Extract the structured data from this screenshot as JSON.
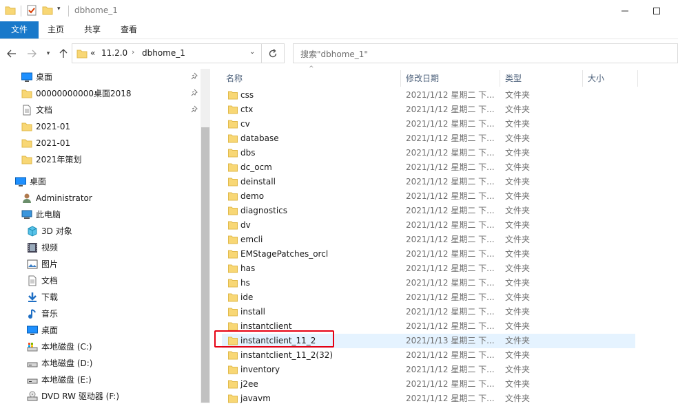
{
  "window": {
    "title": "dbhome_1"
  },
  "ribbon": {
    "tabs": [
      "文件",
      "主页",
      "共享",
      "查看"
    ]
  },
  "address": {
    "overflow": "«",
    "segments": [
      "11.2.0",
      "dbhome_1"
    ]
  },
  "search": {
    "placeholder": "搜索\"dbhome_1\""
  },
  "nav": {
    "quick_access": [
      {
        "label": "桌面",
        "icon": "desktop-icon",
        "pinned": true
      },
      {
        "label": "00000000000桌面2018",
        "icon": "folder-icon",
        "pinned": true
      },
      {
        "label": "文档",
        "icon": "document-icon",
        "pinned": true
      },
      {
        "label": "2021-01",
        "icon": "folder-icon",
        "pinned": false
      },
      {
        "label": "2021-01",
        "icon": "folder-icon",
        "pinned": false
      },
      {
        "label": "2021年策划",
        "icon": "folder-icon",
        "pinned": false
      }
    ],
    "desktop_label": "桌面",
    "user_label": "Administrator",
    "pc_label": "此电脑",
    "pc_items": [
      {
        "label": "3D 对象",
        "icon": "cube-3d-icon"
      },
      {
        "label": "视频",
        "icon": "video-icon"
      },
      {
        "label": "图片",
        "icon": "pictures-icon"
      },
      {
        "label": "文档",
        "icon": "document-icon"
      },
      {
        "label": "下载",
        "icon": "download-icon"
      },
      {
        "label": "音乐",
        "icon": "music-icon"
      },
      {
        "label": "桌面",
        "icon": "desktop-icon"
      },
      {
        "label": "本地磁盘 (C:)",
        "icon": "system-drive-icon"
      },
      {
        "label": "本地磁盘 (D:)",
        "icon": "drive-icon"
      },
      {
        "label": "本地磁盘 (E:)",
        "icon": "drive-icon"
      },
      {
        "label": "DVD RW 驱动器 (F:)",
        "icon": "dvd-drive-icon"
      }
    ]
  },
  "list": {
    "columns": {
      "name": "名称",
      "modified": "修改日期",
      "type": "类型",
      "size": "大小"
    },
    "files": [
      {
        "name": "css",
        "modified": "2021/1/12 星期二 下...",
        "type": "文件夹"
      },
      {
        "name": "ctx",
        "modified": "2021/1/12 星期二 下...",
        "type": "文件夹"
      },
      {
        "name": "cv",
        "modified": "2021/1/12 星期二 下...",
        "type": "文件夹"
      },
      {
        "name": "database",
        "modified": "2021/1/12 星期二 下...",
        "type": "文件夹"
      },
      {
        "name": "dbs",
        "modified": "2021/1/12 星期二 下...",
        "type": "文件夹"
      },
      {
        "name": "dc_ocm",
        "modified": "2021/1/12 星期二 下...",
        "type": "文件夹"
      },
      {
        "name": "deinstall",
        "modified": "2021/1/12 星期二 下...",
        "type": "文件夹"
      },
      {
        "name": "demo",
        "modified": "2021/1/12 星期二 下...",
        "type": "文件夹"
      },
      {
        "name": "diagnostics",
        "modified": "2021/1/12 星期二 下...",
        "type": "文件夹"
      },
      {
        "name": "dv",
        "modified": "2021/1/12 星期二 下...",
        "type": "文件夹"
      },
      {
        "name": "emcli",
        "modified": "2021/1/12 星期二 下...",
        "type": "文件夹"
      },
      {
        "name": "EMStagePatches_orcl",
        "modified": "2021/1/12 星期二 下...",
        "type": "文件夹"
      },
      {
        "name": "has",
        "modified": "2021/1/12 星期二 下...",
        "type": "文件夹"
      },
      {
        "name": "hs",
        "modified": "2021/1/12 星期二 下...",
        "type": "文件夹"
      },
      {
        "name": "ide",
        "modified": "2021/1/12 星期二 下...",
        "type": "文件夹"
      },
      {
        "name": "install",
        "modified": "2021/1/12 星期二 下...",
        "type": "文件夹"
      },
      {
        "name": "instantclient",
        "modified": "2021/1/12 星期二 下...",
        "type": "文件夹"
      },
      {
        "name": "instantclient_11_2",
        "modified": "2021/1/13 星期三 下...",
        "type": "文件夹",
        "selected": true
      },
      {
        "name": "instantclient_11_2(32)",
        "modified": "2021/1/12 星期二 下...",
        "type": "文件夹"
      },
      {
        "name": "inventory",
        "modified": "2021/1/12 星期二 下...",
        "type": "文件夹"
      },
      {
        "name": "j2ee",
        "modified": "2021/1/12 星期二 下...",
        "type": "文件夹"
      },
      {
        "name": "javavm",
        "modified": "2021/1/12 星期二 下...",
        "type": "文件夹"
      }
    ]
  },
  "colors": {
    "accent": "#1979ca",
    "selection": "#e5f3ff",
    "folder": "#f8d775",
    "annotation": "#e60012"
  }
}
